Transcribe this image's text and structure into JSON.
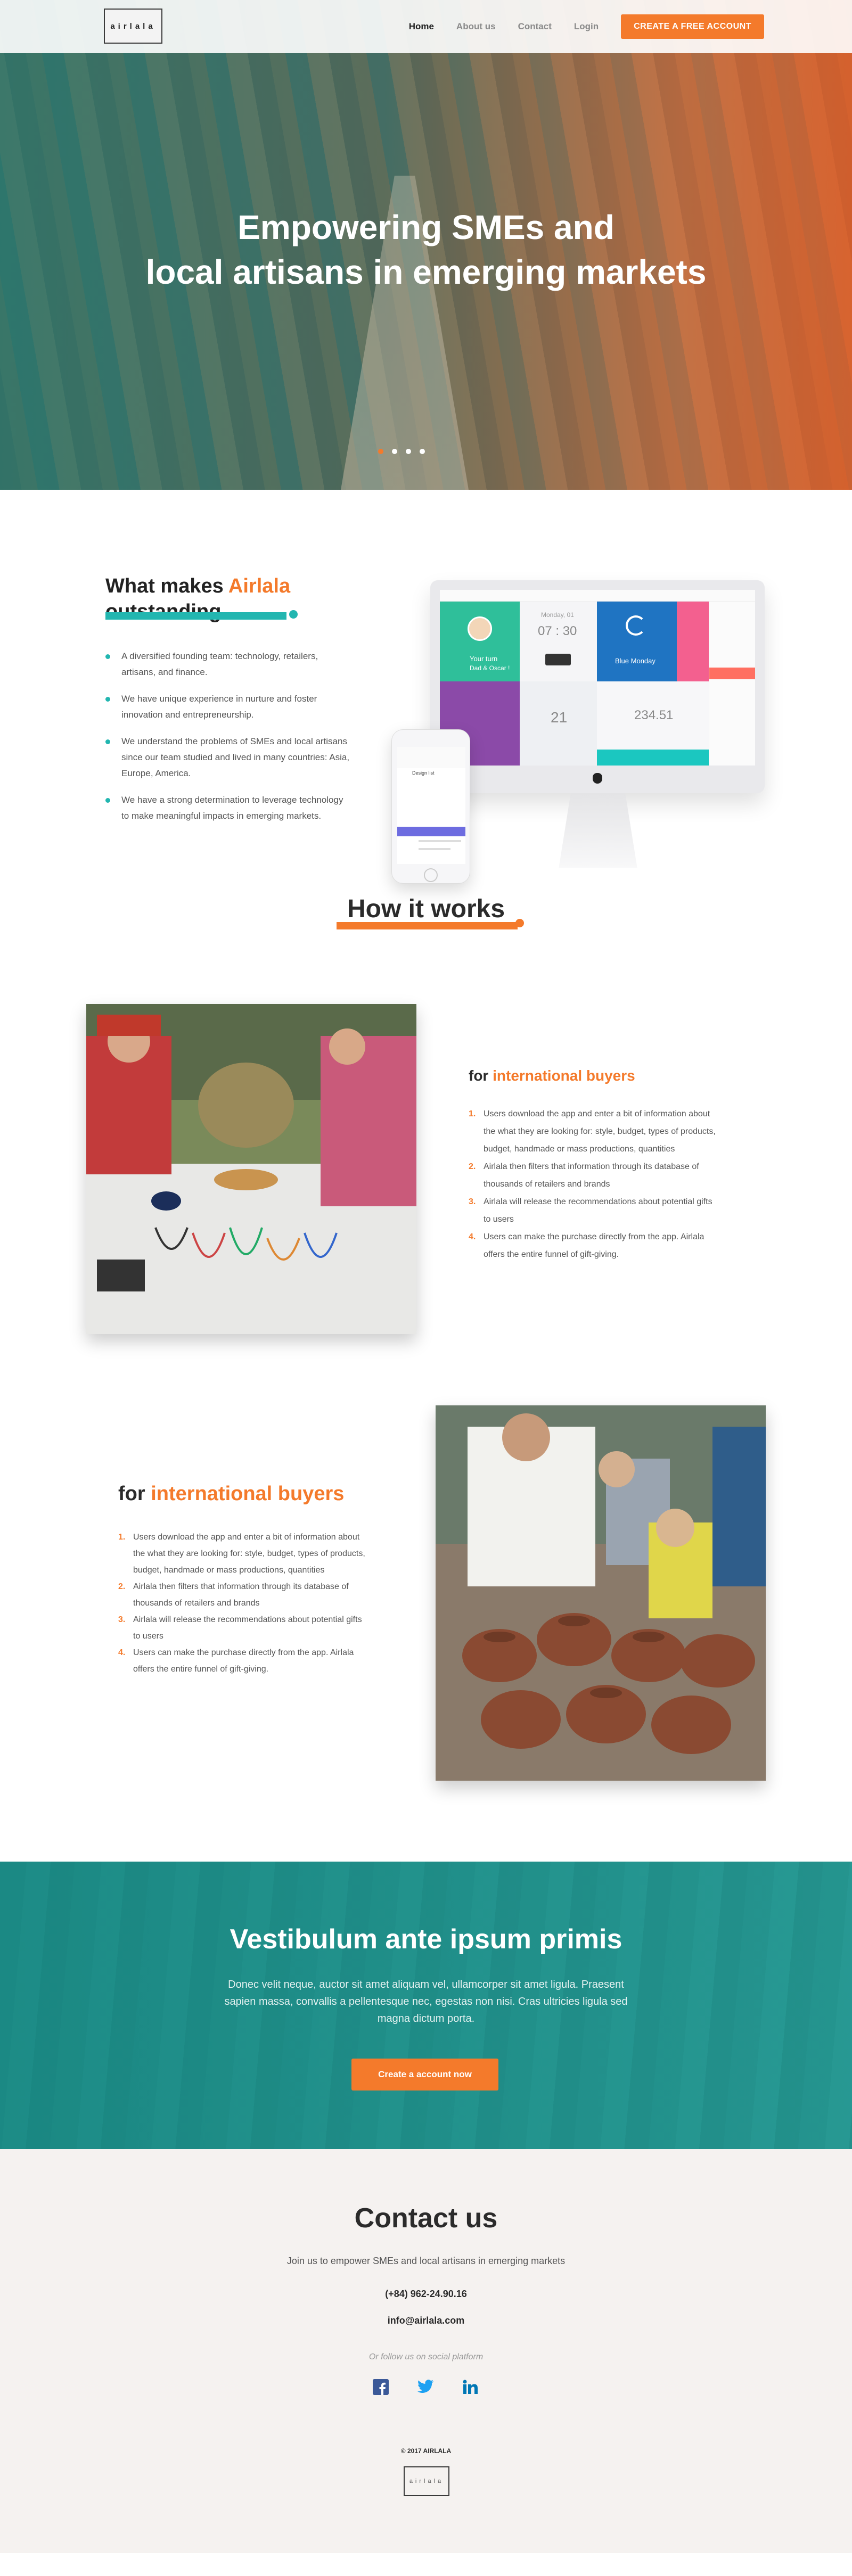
{
  "nav": {
    "logo": "airlala",
    "items": [
      {
        "label": "Home",
        "active": true
      },
      {
        "label": "About us",
        "active": false
      },
      {
        "label": "Contact",
        "active": false
      },
      {
        "label": "Login",
        "active": false
      }
    ],
    "cta": "CREATE A FREE ACCOUNT"
  },
  "hero": {
    "line1": "Empowering SMEs and",
    "line2": "local artisans in emerging markets",
    "slides": 4,
    "active_slide": 0
  },
  "outstanding": {
    "title_prefix": "What makes",
    "title_brand": "Airlala",
    "title_suffix": "outstanding.",
    "points": [
      "A diversified founding team: technology, retailers, artisans, and finance.",
      "We have unique experience in nurture and foster innovation and entrepreneurship.",
      "We understand the problems of SMEs and local artisans since our team studied and lived in many countries: Asia, Europe, America.",
      "We have a strong determination to leverage technology to make meaningful impacts in emerging markets."
    ],
    "device": {
      "clock": "07 : 30",
      "date": "Monday, 01",
      "tile_label": "Blue Monday",
      "temp": "21",
      "value": "234.51",
      "user_name": "Your turn",
      "user_sub": "Dad & Oscar !",
      "phone_title": "Design list"
    }
  },
  "how": {
    "title": "How it works"
  },
  "step1": {
    "title_prefix": "for",
    "title_highlight": "international buyers",
    "items": [
      "Users download the app and enter a bit of information about the what they are looking for: style, budget, types of products, budget, handmade or mass productions, quantities",
      "Airlala then filters that information through its database of thousands of retailers and brands",
      "Airlala will release the recommendations about potential gifts to users",
      "Users can make the purchase directly from the app. Airlala offers the entire funnel of gift-giving."
    ]
  },
  "step2": {
    "title_prefix": "for",
    "title_highlight": "international buyers",
    "items": [
      "Users download the app and enter a bit of information about the what they are looking for: style, budget, types of products, budget, handmade or mass productions, quantities",
      "Airlala then filters that information through its database of thousands of retailers and brands",
      "Airlala will release the recommendations about potential gifts to users",
      "Users can make the purchase directly from the app. Airlala offers the entire funnel of gift-giving."
    ]
  },
  "cta": {
    "title": "Vestibulum ante ipsum primis",
    "body": "Donec velit neque, auctor sit amet aliquam vel, ullamcorper sit amet ligula. Praesent sapien massa, convallis a pellentesque nec, egestas non nisi. Cras ultricies ligula sed magna dictum porta.",
    "button": "Create a account now"
  },
  "contact": {
    "title": "Contact us",
    "subtitle": "Join us to empower SMEs and local artisans in emerging markets",
    "phone": "(+84) 962-24.90.16",
    "email": "info@airlala.com",
    "follow": "Or follow us on social platform",
    "socials": [
      "facebook-icon",
      "twitter-icon",
      "linkedin-icon"
    ],
    "copyright": "© 2017 AIRLALA",
    "footer_logo": "airlala"
  },
  "colors": {
    "accent": "#f47a2b",
    "teal": "#22b6b0",
    "facebook": "#3b5998",
    "twitter": "#1da1f2",
    "linkedin": "#0077b5"
  }
}
